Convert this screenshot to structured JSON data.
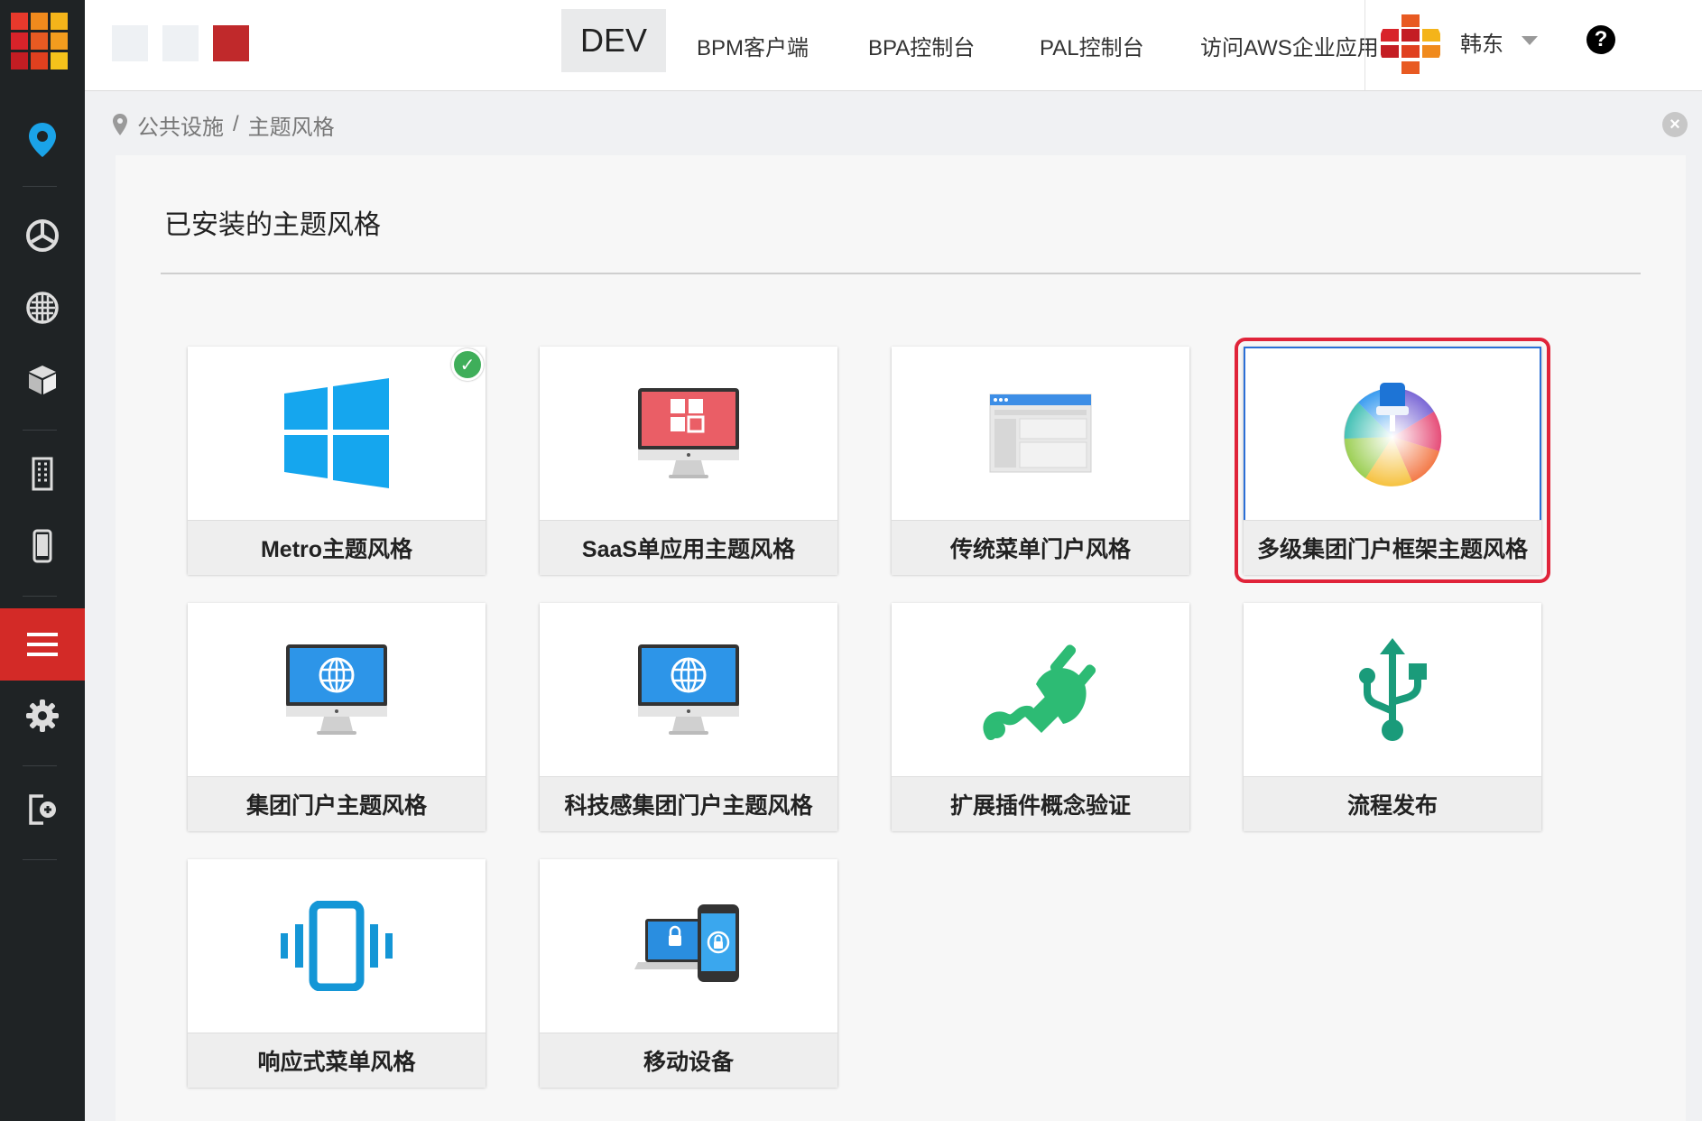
{
  "colors": {
    "sidebar_bg": "#1f2325",
    "sidebar_active": "#d32a27",
    "accent_blue": "#1aa3e8",
    "selection_red": "#e0243a",
    "installed_green": "#3fae5a"
  },
  "header": {
    "nav": [
      "DEV",
      "BPM客户端",
      "BPA控制台",
      "PAL控制台",
      "访问AWS企业应用商店"
    ],
    "user_name": "韩东",
    "help_glyph": "?"
  },
  "sidebar": {
    "items": [
      {
        "icon": "location-pin-icon"
      },
      {
        "icon": "dashboard-icon"
      },
      {
        "icon": "globe-grid-icon"
      },
      {
        "icon": "cube-icon"
      },
      {
        "icon": "building-icon"
      },
      {
        "icon": "mobile-icon"
      },
      {
        "icon": "menu-icon",
        "active": true
      },
      {
        "icon": "gear-icon"
      },
      {
        "icon": "logout-icon"
      }
    ]
  },
  "breadcrumb": {
    "root": "公共设施",
    "separator": "/",
    "current": "主题风格"
  },
  "main": {
    "section_title": "已安装的主题风格",
    "themes": [
      {
        "label": "Metro主题风格",
        "icon": "windows-logo-icon",
        "installed": true
      },
      {
        "label": "SaaS单应用主题风格",
        "icon": "monitor-red-icon"
      },
      {
        "label": "传统菜单门户风格",
        "icon": "browser-window-icon"
      },
      {
        "label": "多级集团门户框架主题风格",
        "icon": "color-wheel-brush-icon",
        "selected": true
      },
      {
        "label": "集团门户主题风格",
        "icon": "monitor-globe-icon"
      },
      {
        "label": "科技感集团门户主题风格",
        "icon": "monitor-globe-icon"
      },
      {
        "label": "扩展插件概念验证",
        "icon": "plug-icon"
      },
      {
        "label": "流程发布",
        "icon": "usb-icon"
      },
      {
        "label": "响应式菜单风格",
        "icon": "vibrating-phone-icon"
      },
      {
        "label": "移动设备",
        "icon": "laptop-phone-lock-icon"
      }
    ]
  }
}
